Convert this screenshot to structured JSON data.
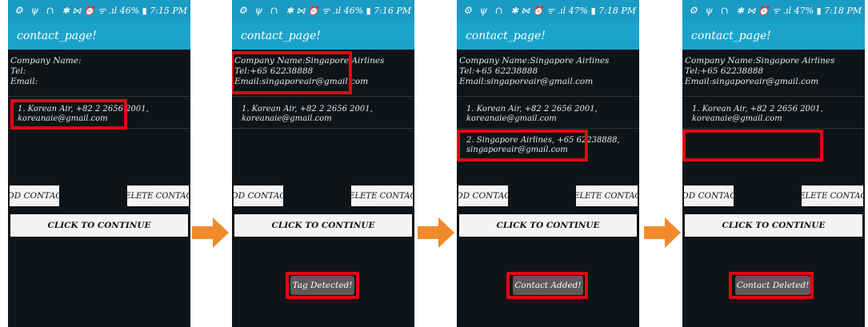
{
  "colors": {
    "status_bar": "#1a9bc4",
    "title_bar": "#1aa4cc",
    "screen_bg": "#0f1418",
    "highlight": "#e30613",
    "arrow": "#f08a2c",
    "toast_bg": "#5a5a5a"
  },
  "screens": [
    {
      "status_icons": "⚙ ψ ∩",
      "status_right": "✱ ⋈ ⏰ ᯤ .ıl 46% ▮ 7:15 PM",
      "title": "contact_page!",
      "company_name": "Company Name:",
      "tel": "Tel:",
      "email": "Email:",
      "list_items": [
        "1. Korean Air, +82 2 2656 2001,\nkoreanaie@gmail.com"
      ],
      "add_button": "ADD CONTACT",
      "delete_button": "DELETE CONTACT",
      "continue_button": "CLICK TO CONTINUE",
      "toast": ""
    },
    {
      "status_icons": "⚙ ψ ∩",
      "status_right": "✱ ⋈ ⏰ ᯤ .ıl 46% ▮ 7:16 PM",
      "title": "contact_page!",
      "company_name": "Company Name:Singapore Airlines",
      "tel": "Tel:+65 62238888",
      "email": "Email:singaporeair@gmail.com",
      "list_items": [
        "1. Korean Air, +82 2 2656 2001,\nkoreanaie@gmail.com"
      ],
      "add_button": "ADD CONTACT",
      "delete_button": "DELETE CONTACT",
      "continue_button": "CLICK TO CONTINUE",
      "toast": "Tag Detected!"
    },
    {
      "status_icons": "⚙ ψ ∩",
      "status_right": "✱ ⋈ ⏰ ᯤ .ıl 47% ▮ 7:18 PM",
      "title": "contact_page!",
      "company_name": "Company Name:Singapore Airlines",
      "tel": "Tel:+65 62238888",
      "email": "Email:singaporeair@gmail.com",
      "list_items": [
        "1. Korean Air, +82 2 2656 2001,\nkoreanaie@gmail.com",
        "2. Singapore Airlines, +65 62238888,\nsingaporeair@gmail.com"
      ],
      "add_button": "ADD CONTACT",
      "delete_button": "DELETE CONTACT",
      "continue_button": "CLICK TO CONTINUE",
      "toast": "Contact Added!"
    },
    {
      "status_icons": "⚙ ψ ∩",
      "status_right": "✱ ⋈ ⏰ ᯤ .ıl 47% ▮ 7:18 PM",
      "title": "contact_page!",
      "company_name": "Company Name:Singapore Airlines",
      "tel": "Tel:+65 62238888",
      "email": "Email:singaporeair@gmail.com",
      "list_items": [
        "1. Korean Air, +82 2 2656 2001,\nkoreanaie@gmail.com"
      ],
      "add_button": "ADD CONTACT",
      "delete_button": "DELETE CONTACT",
      "continue_button": "CLICK TO CONTINUE",
      "toast": "Contact Deleted!"
    }
  ]
}
